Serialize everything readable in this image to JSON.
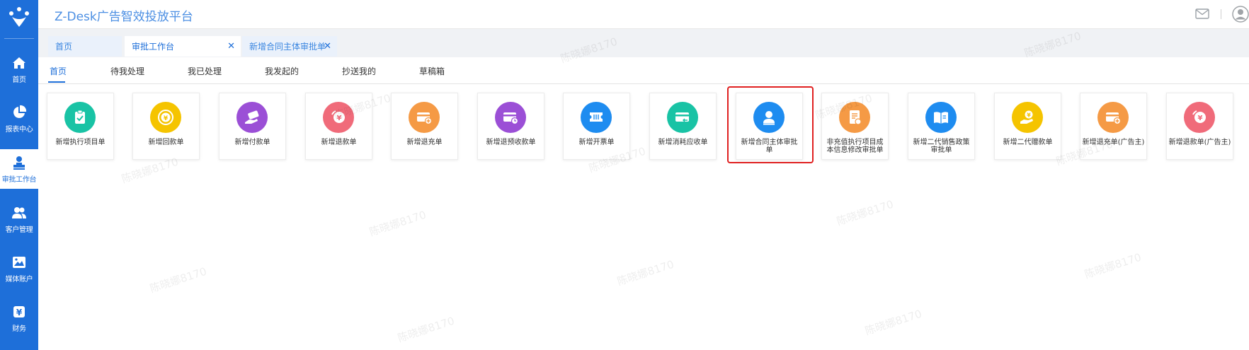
{
  "app": {
    "title": "Z-Desk广告智效投放平台"
  },
  "sidebar": {
    "items": [
      {
        "label": "首页",
        "icon": "home-icon",
        "active": false
      },
      {
        "label": "报表中心",
        "icon": "pie-chart-icon",
        "active": false
      },
      {
        "label": "审批工作台",
        "icon": "approval-stamp-icon",
        "active": true
      },
      {
        "label": "客户管理",
        "icon": "customers-icon",
        "active": false
      },
      {
        "label": "媒体账户",
        "icon": "media-account-icon",
        "active": false
      },
      {
        "label": "财务",
        "icon": "yen-icon",
        "active": false
      }
    ]
  },
  "tabs": [
    {
      "label": "首页",
      "closable": false
    },
    {
      "label": "审批工作台",
      "closable": true,
      "active": true
    },
    {
      "label": "新增合同主体审批单",
      "closable": true
    }
  ],
  "subnav": {
    "items": [
      "首页",
      "待我处理",
      "我已处理",
      "我发起的",
      "抄送我的",
      "草稿箱"
    ],
    "active_index": 0
  },
  "cards": [
    {
      "label": "新增执行项目单",
      "icon": "clipboard-check-icon",
      "color": "#19c3a5"
    },
    {
      "label": "新增回款单",
      "icon": "yen-coin-icon",
      "color": "#f5c400"
    },
    {
      "label": "新增付款单",
      "icon": "payment-hand-icon",
      "color": "#9b4fd6"
    },
    {
      "label": "新增退款单",
      "icon": "refund-yen-icon",
      "color": "#f06b7a"
    },
    {
      "label": "新增退充单",
      "icon": "card-plus-icon",
      "color": "#f59a45"
    },
    {
      "label": "新增退预收款单",
      "icon": "card-clock-icon",
      "color": "#9b4fd6"
    },
    {
      "label": "新增开票单",
      "icon": "invoice-ticket-icon",
      "color": "#1e8cf0"
    },
    {
      "label": "新增消耗应收单",
      "icon": "card-return-icon",
      "color": "#19c3a5"
    },
    {
      "label": "新增合同主体审批单",
      "icon": "person-stamp-icon",
      "color": "#1e8cf0",
      "highlighted": true
    },
    {
      "label": "非充值执行项目成本信息修改审批单",
      "icon": "document-list-icon",
      "color": "#f59a45"
    },
    {
      "label": "新增二代销售政策审批单",
      "icon": "open-book-icon",
      "color": "#1e8cf0"
    },
    {
      "label": "新增二代赠款单",
      "icon": "hand-coin-icon",
      "color": "#f5c400"
    },
    {
      "label": "新增退充单(广告主)",
      "icon": "card-plus-icon",
      "color": "#f59a45"
    },
    {
      "label": "新增退款单(广告主)",
      "icon": "refund-yen-icon",
      "color": "#f06b7a"
    }
  ],
  "watermark": "陈晓娜8170"
}
